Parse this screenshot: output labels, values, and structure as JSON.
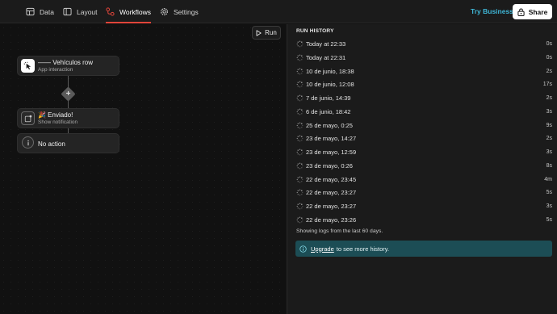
{
  "nav": {
    "items": [
      {
        "label": "Data",
        "icon": "table-icon"
      },
      {
        "label": "Layout",
        "icon": "layout-icon"
      },
      {
        "label": "Workflows",
        "icon": "workflow-icon",
        "active": true
      },
      {
        "label": "Settings",
        "icon": "gear-icon"
      }
    ],
    "try_business": "Try Business",
    "share_label": "Share"
  },
  "canvas": {
    "run_label": "Run",
    "nodes": [
      {
        "title": "—— Vehículos row",
        "subtitle": "App interaction",
        "icon": "pointer-click-icon"
      },
      {
        "title": "🎉 Enviado!",
        "subtitle": "Show notification",
        "icon": "notification-icon"
      },
      {
        "title": "No action",
        "subtitle": "",
        "icon": "info-icon"
      }
    ]
  },
  "run_history": {
    "title": "RUN HISTORY",
    "rows": [
      {
        "when": "Today at 22:33",
        "duration": "0s"
      },
      {
        "when": "Today at 22:31",
        "duration": "0s"
      },
      {
        "when": "10 de junio, 18:38",
        "duration": "2s"
      },
      {
        "when": "10 de junio, 12:08",
        "duration": "17s"
      },
      {
        "when": "7 de junio, 14:39",
        "duration": "2s"
      },
      {
        "when": "6 de junio, 18:42",
        "duration": "3s"
      },
      {
        "when": "25 de mayo, 0:25",
        "duration": "9s"
      },
      {
        "when": "23 de mayo, 14:27",
        "duration": "2s"
      },
      {
        "when": "23 de mayo, 12:59",
        "duration": "3s"
      },
      {
        "when": "23 de mayo, 0:26",
        "duration": "8s"
      },
      {
        "when": "22 de mayo, 23:45",
        "duration": "4m"
      },
      {
        "when": "22 de mayo, 23:27",
        "duration": "5s"
      },
      {
        "when": "22 de mayo, 23:27",
        "duration": "3s"
      },
      {
        "when": "22 de mayo, 23:26",
        "duration": "5s"
      }
    ],
    "footer_note": "Showing logs from the last 60 days.",
    "upgrade_link": "Upgrade",
    "upgrade_text": "to see more history."
  },
  "colors": {
    "accent_red": "#e0453a",
    "accent_cyan": "#3fb6d6",
    "upgrade_bg": "#1c4d55"
  }
}
